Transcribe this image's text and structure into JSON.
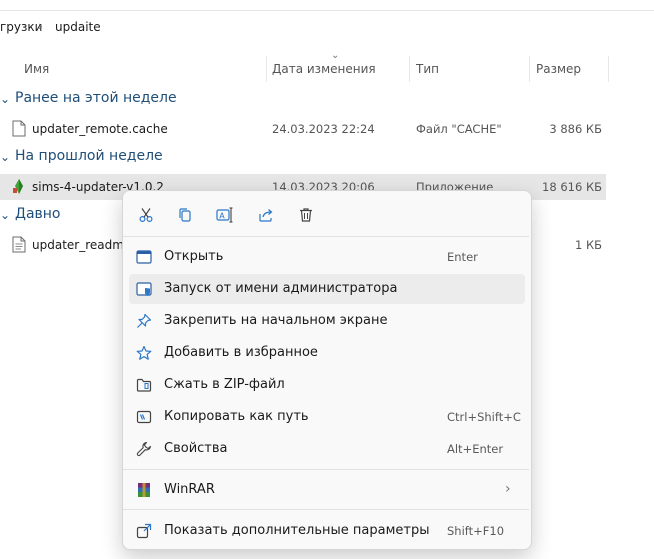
{
  "breadcrumb": {
    "parent": "грузки",
    "separator": "›",
    "current": "updaite"
  },
  "columns": {
    "name": "Имя",
    "date": "Дата изменения",
    "type": "Тип",
    "size": "Размер"
  },
  "groups": [
    {
      "label": "Ранее на этой неделе"
    },
    {
      "label": "На прошлой неделе"
    },
    {
      "label": "Давно"
    }
  ],
  "files": [
    {
      "name": "updater_remote.cache",
      "date": "24.03.2023 22:24",
      "type": "Файл \"CACHE\"",
      "size": "3 886 КБ"
    },
    {
      "name": "sims-4-updater-v1.0.2",
      "date": "14.03.2023 20:06",
      "type": "Приложение",
      "size": "18 616 КБ"
    },
    {
      "name": "updater_readme",
      "date": "",
      "type": "",
      "size": "1 КБ"
    }
  ],
  "context_menu": {
    "quick_actions": [
      "cut-icon",
      "copy-icon",
      "rename-icon",
      "share-icon",
      "delete-icon"
    ],
    "items": [
      {
        "icon": "open-icon",
        "label": "Открыть",
        "shortcut": "Enter"
      },
      {
        "icon": "shield-icon",
        "label": "Запуск от имени администратора",
        "shortcut": ""
      },
      {
        "icon": "pin-icon",
        "label": "Закрепить на начальном экране",
        "shortcut": ""
      },
      {
        "icon": "star-icon",
        "label": "Добавить в избранное",
        "shortcut": ""
      },
      {
        "icon": "zip-icon",
        "label": "Сжать в ZIP-файл",
        "shortcut": ""
      },
      {
        "icon": "copy-path-icon",
        "label": "Копировать как путь",
        "shortcut": "Ctrl+Shift+C"
      },
      {
        "icon": "wrench-icon",
        "label": "Свойства",
        "shortcut": "Alt+Enter"
      }
    ],
    "winrar": {
      "icon": "winrar-icon",
      "label": "WinRAR"
    },
    "more": {
      "icon": "more-options-icon",
      "label": "Показать дополнительные параметры",
      "shortcut": "Shift+F10"
    }
  },
  "colors": {
    "group_header": "#1f4e79",
    "accent": "#2b77c9",
    "selection": "#e6e6e6"
  }
}
